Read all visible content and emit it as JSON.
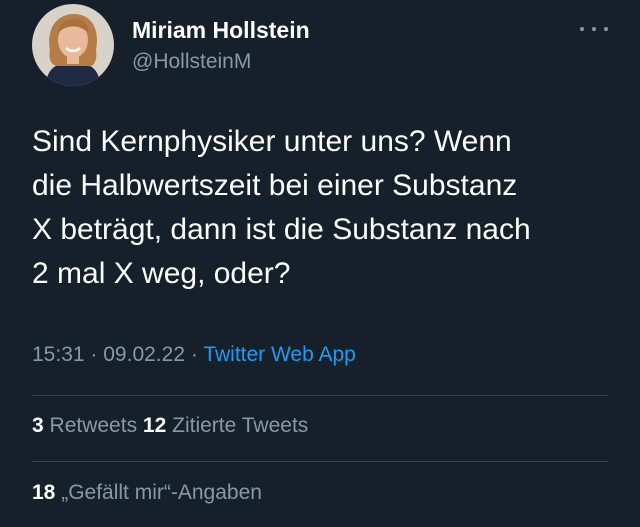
{
  "author": {
    "display_name": "Miriam Hollstein",
    "handle": "@HollsteinM"
  },
  "tweet": {
    "text": "Sind Kernphysiker unter uns? Wenn\ndie Halbwertszeit bei einer Substanz\nX beträgt, dann ist die Substanz nach\n2 mal X weg, oder?",
    "time": "15:31",
    "date": "09.02.22",
    "separator": "·",
    "source": "Twitter Web App"
  },
  "stats": {
    "retweets_count": "3",
    "retweets_label": "Retweets",
    "quotes_count": "12",
    "quotes_label": "Zitierte Tweets",
    "likes_count": "18",
    "likes_label": "„Gefällt mir“-Angaben"
  },
  "icons": {
    "more": "more-horizontal-icon",
    "avatar": "profile-photo"
  },
  "colors": {
    "background": "#15202b",
    "secondary_text": "#8899a6",
    "link": "#1d9bf0",
    "divider": "#38444d"
  }
}
